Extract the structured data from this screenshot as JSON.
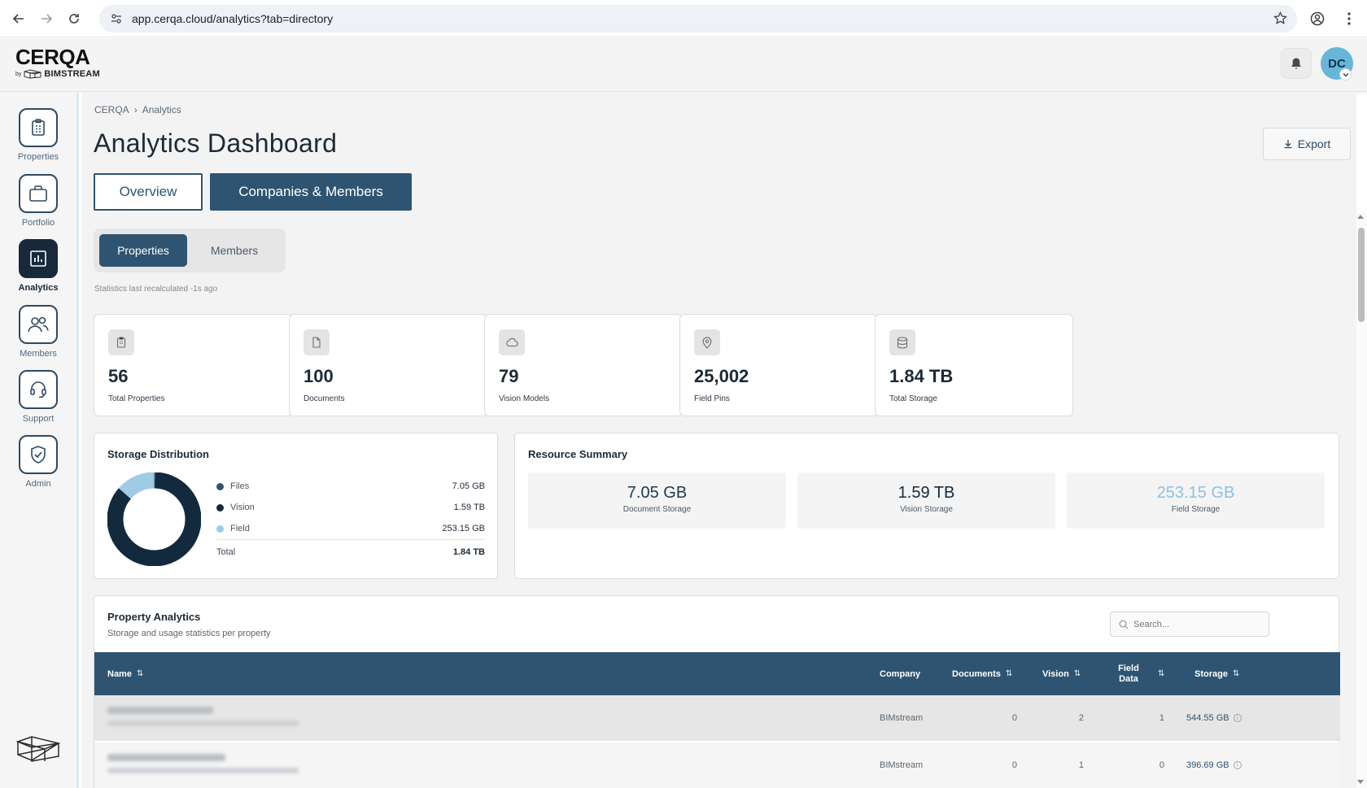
{
  "browser": {
    "url": "app.cerqa.cloud/analytics?tab=directory"
  },
  "header": {
    "logo": "CERQA",
    "logo_by": "by",
    "logo_brand": "BIMSTREAM",
    "avatar_initials": "DC"
  },
  "sidebar": {
    "items": [
      {
        "label": "Properties",
        "icon": "clipboard-icon",
        "active": false
      },
      {
        "label": "Portfolio",
        "icon": "briefcase-icon",
        "active": false
      },
      {
        "label": "Analytics",
        "icon": "bar-chart-icon",
        "active": true
      },
      {
        "label": "Members",
        "icon": "users-icon",
        "active": false
      },
      {
        "label": "Support",
        "icon": "headset-icon",
        "active": false
      },
      {
        "label": "Admin",
        "icon": "shield-check-icon",
        "active": false
      }
    ]
  },
  "main": {
    "breadcrumb": [
      "CERQA",
      "Analytics"
    ],
    "breadcrumb_sep": "›",
    "title": "Analytics Dashboard",
    "export_label": "Export",
    "tabs": [
      {
        "label": "Overview",
        "active": false
      },
      {
        "label": "Companies & Members",
        "active": true
      }
    ],
    "segments": [
      {
        "label": "Properties",
        "active": true
      },
      {
        "label": "Members",
        "active": false
      }
    ],
    "stats_note": "Statistics last recalculated -1s ago",
    "kpis": [
      {
        "value": "56",
        "label": "Total Properties",
        "icon": "clipboard-icon"
      },
      {
        "value": "100",
        "label": "Documents",
        "icon": "document-icon"
      },
      {
        "value": "79",
        "label": "Vision Models",
        "icon": "cloud-icon"
      },
      {
        "value": "25,002",
        "label": "Field Pins",
        "icon": "map-pin-icon"
      },
      {
        "value": "1.84 TB",
        "label": "Total Storage",
        "icon": "database-icon"
      }
    ],
    "storage_distribution": {
      "title": "Storage Distribution",
      "items": [
        {
          "label": "Files",
          "value": "7.05 GB",
          "color": "#2e5472"
        },
        {
          "label": "Vision",
          "value": "1.59 TB",
          "color": "#132a3e"
        },
        {
          "label": "Field",
          "value": "253.15 GB",
          "color": "#9fcbe7"
        }
      ],
      "total_label": "Total",
      "total_value": "1.84 TB"
    },
    "resource_summary": {
      "title": "Resource Summary",
      "items": [
        {
          "value": "7.05 GB",
          "label": "Document Storage",
          "color": "#1e3a52"
        },
        {
          "value": "1.59 TB",
          "label": "Vision Storage",
          "color": "#132a3e"
        },
        {
          "value": "253.15 GB",
          "label": "Field Storage",
          "color": "#8ec1e3"
        }
      ]
    },
    "property_analytics": {
      "title": "Property Analytics",
      "subtitle": "Storage and usage statistics per property",
      "search_placeholder": "Search...",
      "columns": [
        "Name",
        "Company",
        "Documents",
        "Vision",
        "Field Data",
        "Storage"
      ],
      "rows": [
        {
          "company": "BIMstream",
          "documents": "0",
          "vision": "2",
          "field_data": "1",
          "storage": "544.55 GB"
        },
        {
          "company": "BIMstream",
          "documents": "0",
          "vision": "1",
          "field_data": "0",
          "storage": "396.69 GB"
        }
      ]
    }
  },
  "chart_data": {
    "type": "pie",
    "categories": [
      "Files",
      "Vision",
      "Field"
    ],
    "values": [
      7.05,
      1590,
      253.15
    ],
    "unit": "GB",
    "title": "Storage Distribution"
  }
}
